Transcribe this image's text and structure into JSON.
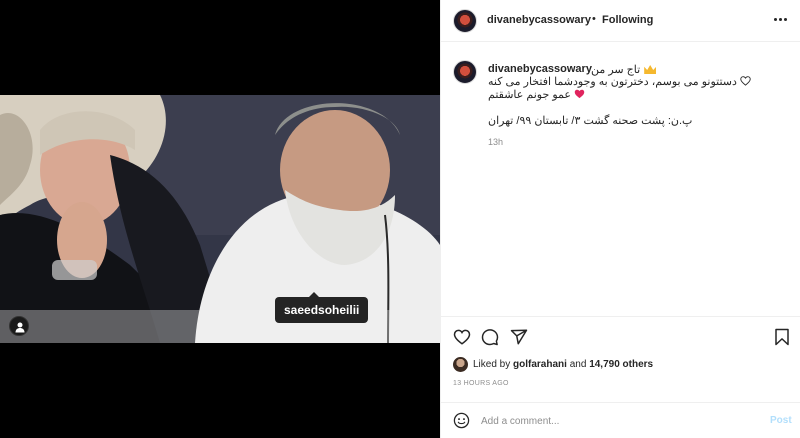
{
  "post": {
    "media": {
      "tagged_user": "saeedsoheilii"
    },
    "header": {
      "username": "divanebycassowary",
      "separator": "•",
      "follow_status": "Following"
    },
    "caption": {
      "username": "divanebycassowary",
      "line1": "تاج سر من",
      "line2": "دستتونو می بوسم، دخترتون به وجودشما افتخار می کنه",
      "line3": "عمو جونم عاشقتم",
      "line4": "پ.ن: پشت صحنه گشت ۳/ تابستان ۹۹/ تهران",
      "time": "13h"
    },
    "likes": {
      "prefix": "Liked by",
      "user": "golfarahani",
      "conjunction": "and",
      "others": "14,790 others"
    },
    "timestamp": "13 HOURS AGO",
    "comment": {
      "placeholder": "Add a comment...",
      "post_label": "Post"
    },
    "colors": {
      "accent_disabled": "#b2dffc",
      "heart_red": "#e0245e",
      "crown_gold": "#f5b82e"
    },
    "icons": [
      "more-icon",
      "heart-icon",
      "comment-icon",
      "share-icon",
      "bookmark-icon",
      "emoji-icon",
      "user-tag-icon"
    ]
  }
}
